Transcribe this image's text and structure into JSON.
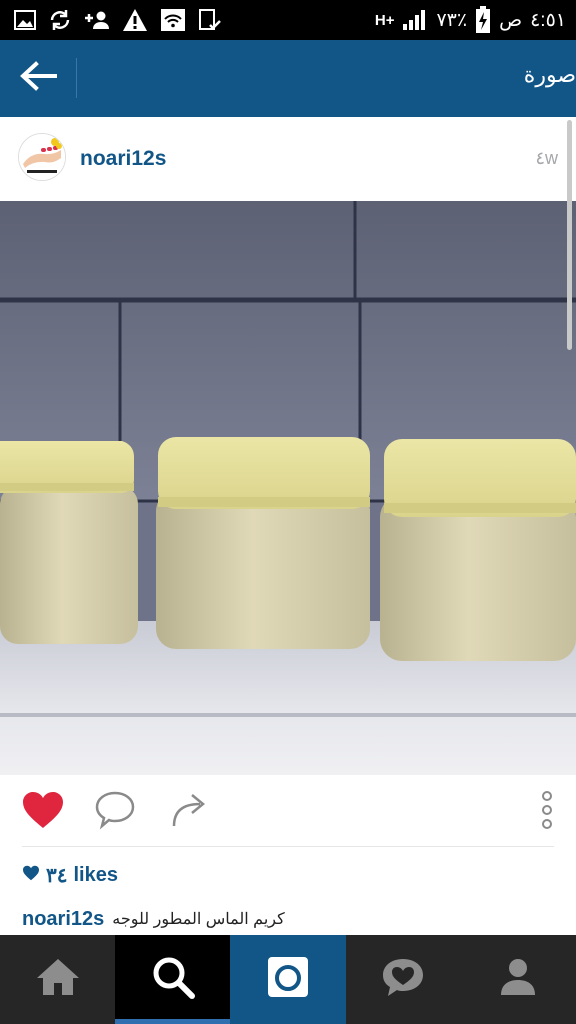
{
  "status_bar": {
    "time": "٤:٥١",
    "am_pm": "ص",
    "battery": "٧٣٪",
    "network": "H+",
    "left_icons": [
      "gallery-icon",
      "sync-icon",
      "add-contact-icon",
      "warning-icon",
      "wifi-check-icon",
      "clipboard-check-icon"
    ]
  },
  "app_bar": {
    "title": "صورة",
    "back_icon": "arrow-left-icon"
  },
  "post": {
    "username": "noari12s",
    "time_ago": "٤w",
    "likes_count": "٣٤",
    "likes_word": "likes",
    "caption_user": "noari12s",
    "caption_text": "كريم الماس المطور للوجه",
    "photo_subject": "three jars of cream"
  },
  "actions": {
    "icons": [
      "heart-icon",
      "comment-icon",
      "share-icon",
      "more-icon"
    ],
    "liked": true
  },
  "bottom_nav": {
    "items": [
      "home-icon",
      "search-icon",
      "camera-icon",
      "activity-icon",
      "profile-icon"
    ],
    "active": "search"
  },
  "colors": {
    "brand_blue": "#125688",
    "like_red": "#e0263e",
    "nav_dark": "#262626"
  }
}
